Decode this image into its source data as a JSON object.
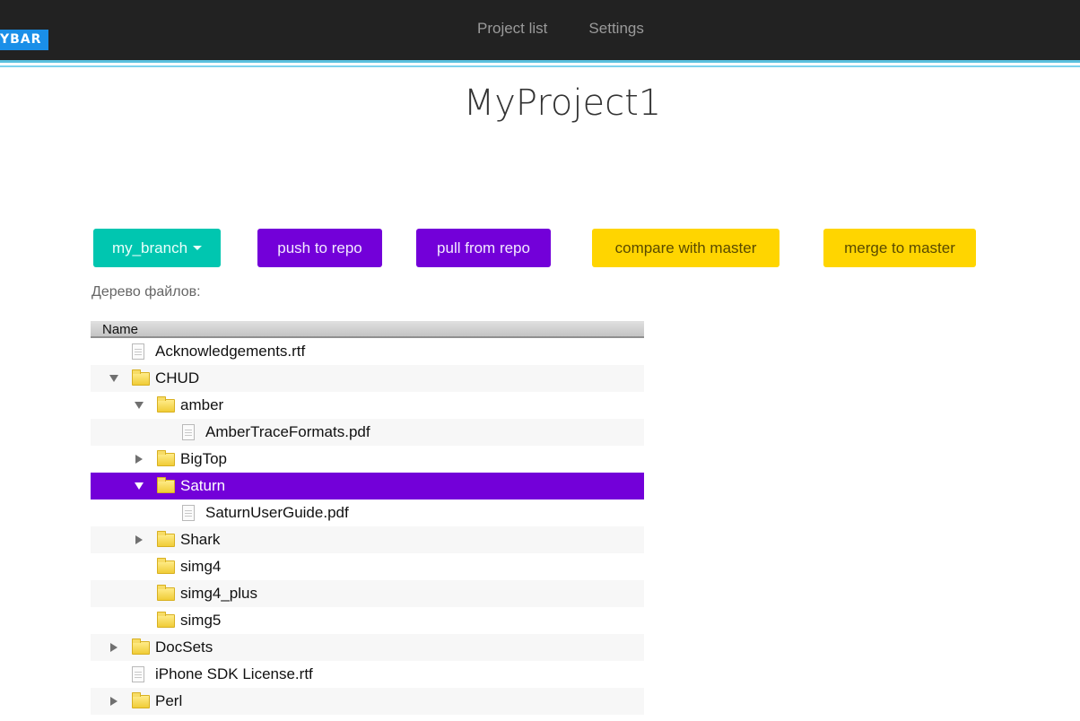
{
  "navbar": {
    "brand": "YBAR",
    "links": [
      "Project list",
      "Settings"
    ]
  },
  "page": {
    "title": "MyProject1"
  },
  "toolbar": {
    "branch_label": "my_branch",
    "push_label": "push to repo",
    "pull_label": "pull from repo",
    "compare_label": "compare with master",
    "merge_label": "merge to master"
  },
  "tree": {
    "label": "Дерево файлов:",
    "column_header": "Name",
    "rows": [
      {
        "name": "Acknowledgements.rtf",
        "type": "file",
        "depth": 0,
        "toggle": "none"
      },
      {
        "name": "CHUD",
        "type": "folder",
        "depth": 0,
        "toggle": "expanded"
      },
      {
        "name": "amber",
        "type": "folder",
        "depth": 1,
        "toggle": "expanded"
      },
      {
        "name": "AmberTraceFormats.pdf",
        "type": "file",
        "depth": 2,
        "toggle": "none"
      },
      {
        "name": "BigTop",
        "type": "folder",
        "depth": 1,
        "toggle": "collapsed"
      },
      {
        "name": "Saturn",
        "type": "folder",
        "depth": 1,
        "toggle": "expanded",
        "selected": true
      },
      {
        "name": "SaturnUserGuide.pdf",
        "type": "file",
        "depth": 2,
        "toggle": "none"
      },
      {
        "name": "Shark",
        "type": "folder",
        "depth": 1,
        "toggle": "collapsed"
      },
      {
        "name": "simg4",
        "type": "folder",
        "depth": 1,
        "toggle": "none"
      },
      {
        "name": "simg4_plus",
        "type": "folder",
        "depth": 1,
        "toggle": "none"
      },
      {
        "name": "simg5",
        "type": "folder",
        "depth": 1,
        "toggle": "none"
      },
      {
        "name": "DocSets",
        "type": "folder",
        "depth": 0,
        "toggle": "collapsed"
      },
      {
        "name": "iPhone SDK License.rtf",
        "type": "file",
        "depth": 0,
        "toggle": "none"
      },
      {
        "name": "Perl",
        "type": "folder",
        "depth": 0,
        "toggle": "collapsed"
      }
    ]
  },
  "colors": {
    "navbar": "#222222",
    "accent_line": "#5bc0de",
    "teal": "#00c6b0",
    "purple": "#7300d9",
    "yellow": "#ffd500"
  }
}
